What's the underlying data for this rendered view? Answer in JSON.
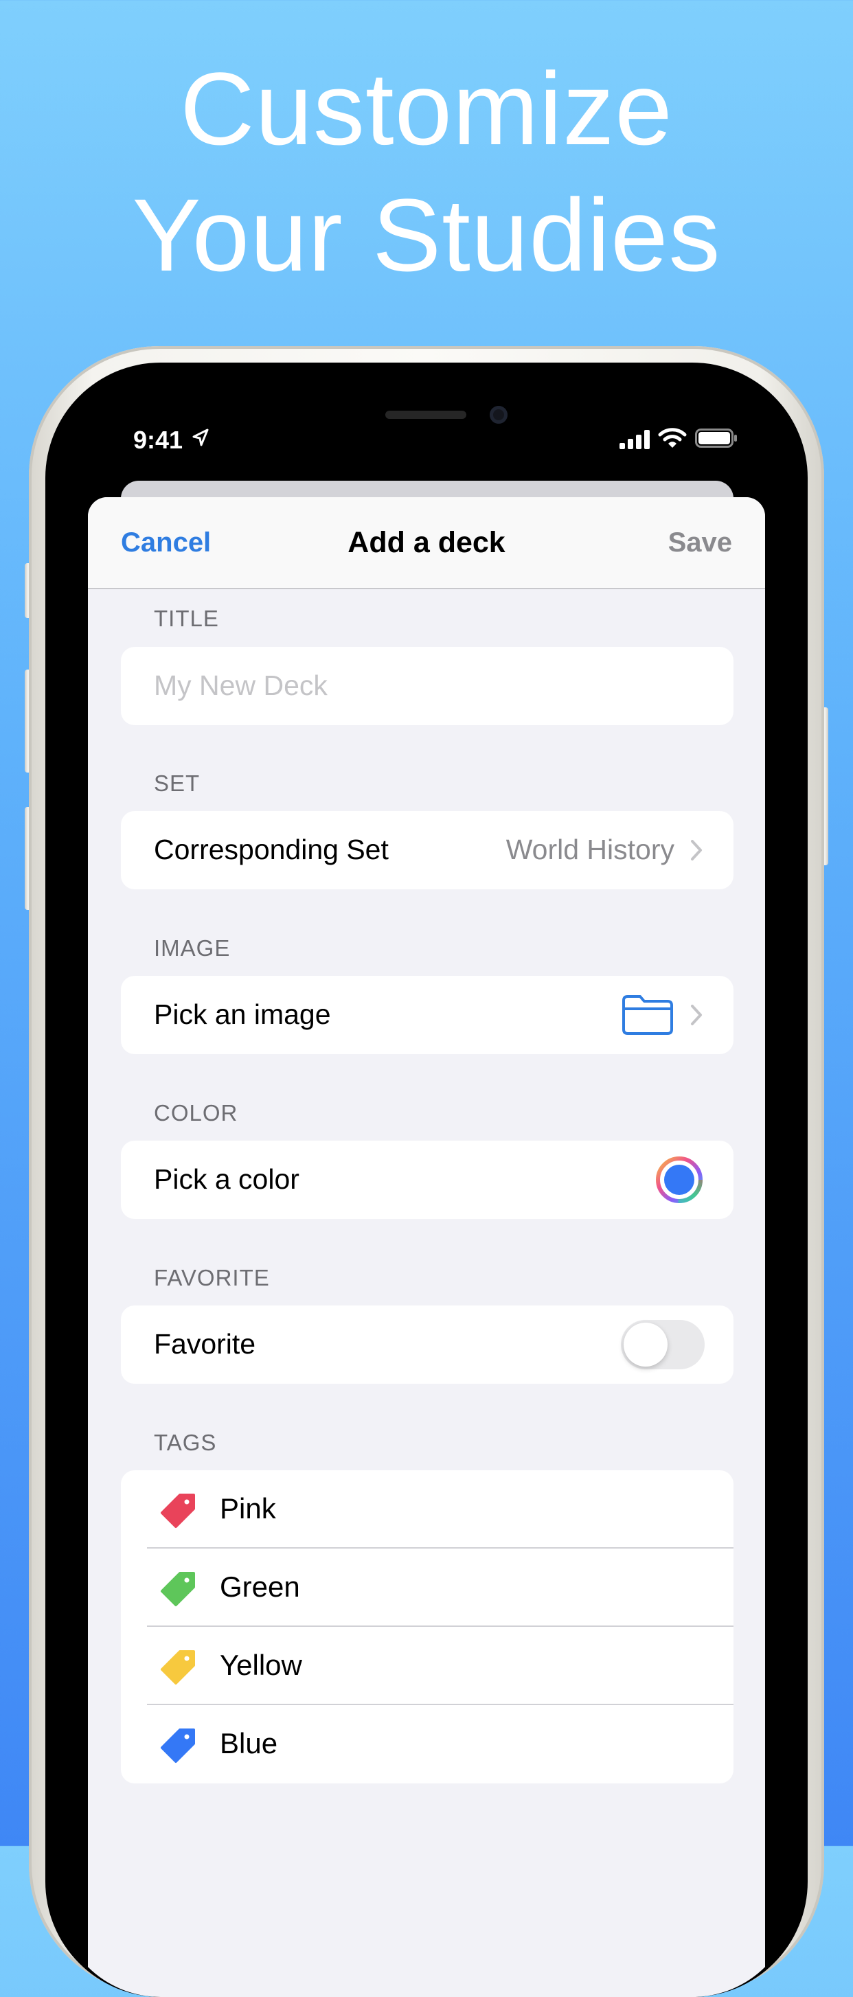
{
  "headline": {
    "line1": "Customize",
    "line2": "Your Studies"
  },
  "status_bar": {
    "time": "9:41"
  },
  "nav": {
    "cancel": "Cancel",
    "title": "Add a deck",
    "save": "Save"
  },
  "sections": {
    "title": {
      "label": "TITLE",
      "placeholder": "My New Deck"
    },
    "set": {
      "label": "SET",
      "row": "Corresponding Set",
      "value": "World History"
    },
    "image": {
      "label": "IMAGE",
      "row": "Pick an image"
    },
    "color": {
      "label": "COLOR",
      "row": "Pick a color",
      "selected": "#3478f6"
    },
    "favorite": {
      "label": "FAVORITE",
      "row": "Favorite",
      "on": false
    },
    "tags": {
      "label": "TAGS",
      "items": [
        {
          "label": "Pink",
          "color": "#e9435a"
        },
        {
          "label": "Green",
          "color": "#5ec65a"
        },
        {
          "label": "Yellow",
          "color": "#f7c93e"
        },
        {
          "label": "Blue",
          "color": "#3478f6"
        }
      ]
    }
  },
  "colors": {
    "accent": "#2f7de1",
    "sheet_bg": "#f2f2f7"
  }
}
